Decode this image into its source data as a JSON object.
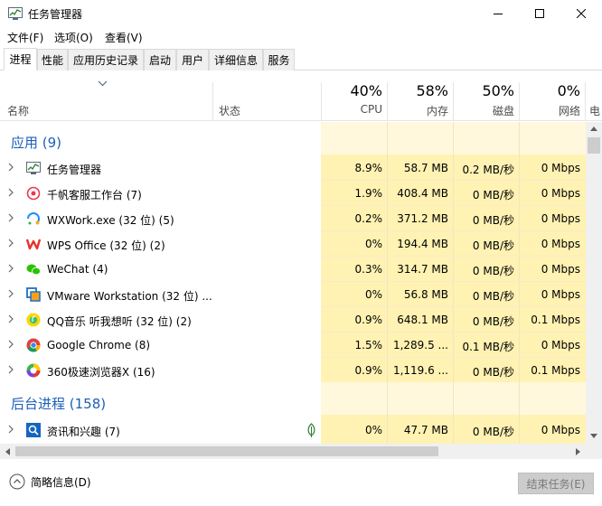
{
  "window": {
    "title": "任务管理器"
  },
  "menu": [
    {
      "label": "文件(F)"
    },
    {
      "label": "选项(O)"
    },
    {
      "label": "查看(V)"
    }
  ],
  "tabs": [
    {
      "label": "进程",
      "active": true
    },
    {
      "label": "性能"
    },
    {
      "label": "应用历史记录"
    },
    {
      "label": "启动"
    },
    {
      "label": "用户"
    },
    {
      "label": "详细信息"
    },
    {
      "label": "服务"
    }
  ],
  "columns": {
    "name": "名称",
    "status": "状态",
    "cpu": {
      "pct": "40%",
      "label": "CPU"
    },
    "memory": {
      "pct": "58%",
      "label": "内存"
    },
    "disk": {
      "pct": "50%",
      "label": "磁盘"
    },
    "network": {
      "pct": "0%",
      "label": "网络"
    },
    "power_partial": "电"
  },
  "sections": [
    {
      "title": "应用 (9)",
      "rows": [
        {
          "name": "任务管理器",
          "icon": "task-manager-icon",
          "cpu": "8.9%",
          "memory": "58.7 MB",
          "disk": "0.2 MB/秒",
          "network": "0 Mbps"
        },
        {
          "name": "千帆客服工作台 (7)",
          "icon": "qianfan-icon",
          "cpu": "1.9%",
          "memory": "408.4 MB",
          "disk": "0 MB/秒",
          "network": "0 Mbps"
        },
        {
          "name": "WXWork.exe (32 位) (5)",
          "icon": "wxwork-icon",
          "cpu": "0.2%",
          "memory": "371.2 MB",
          "disk": "0 MB/秒",
          "network": "0 Mbps"
        },
        {
          "name": "WPS Office (32 位) (2)",
          "icon": "wps-icon",
          "cpu": "0%",
          "memory": "194.4 MB",
          "disk": "0 MB/秒",
          "network": "0 Mbps"
        },
        {
          "name": "WeChat (4)",
          "icon": "wechat-icon",
          "cpu": "0.3%",
          "memory": "314.7 MB",
          "disk": "0 MB/秒",
          "network": "0 Mbps"
        },
        {
          "name": "VMware Workstation (32 位) ...",
          "icon": "vmware-icon",
          "cpu": "0%",
          "memory": "56.8 MB",
          "disk": "0 MB/秒",
          "network": "0 Mbps"
        },
        {
          "name": "QQ音乐 听我想听 (32 位) (2)",
          "icon": "qqmusic-icon",
          "cpu": "0.9%",
          "memory": "648.1 MB",
          "disk": "0 MB/秒",
          "network": "0.1 Mbps"
        },
        {
          "name": "Google Chrome (8)",
          "icon": "chrome-icon",
          "cpu": "1.5%",
          "memory": "1,289.5 ...",
          "disk": "0.1 MB/秒",
          "network": "0 Mbps"
        },
        {
          "name": "360极速浏览器X (16)",
          "icon": "360-browser-icon",
          "cpu": "0.9%",
          "memory": "1,119.6 ...",
          "disk": "0 MB/秒",
          "network": "0.1 Mbps"
        }
      ]
    },
    {
      "title": "后台进程 (158)",
      "rows": [
        {
          "name": "资讯和兴趣 (7)",
          "icon": "news-interests-icon",
          "cpu": "0%",
          "memory": "47.7 MB",
          "disk": "0 MB/秒",
          "network": "0 Mbps",
          "status_icon": "leaf-icon"
        }
      ]
    }
  ],
  "footer": {
    "brief_label": "简略信息(D)",
    "end_task_label": "结束任务(E)"
  },
  "colors": {
    "accent": "#1c5fb8",
    "cell_bg": "#fff2b3",
    "section_bg": "#fff8dc"
  }
}
